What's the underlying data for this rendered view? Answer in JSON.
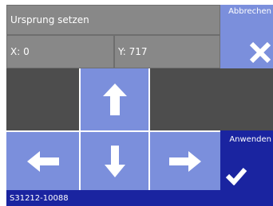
{
  "header": {
    "title": "Ursprung setzen"
  },
  "coords": {
    "x_label": "X: 0",
    "y_label": "Y: 717"
  },
  "actions": {
    "cancel_label": "Abbrechen",
    "apply_label": "Anwenden"
  },
  "icons": {
    "cancel": "close-icon",
    "apply": "checkmark-icon",
    "up": "arrow-up-icon",
    "down": "arrow-down-icon",
    "left": "arrow-left-icon",
    "right": "arrow-right-icon"
  },
  "colors": {
    "field": "#888888",
    "tile_dark": "#4d4d4d",
    "accent_light": "#7b8fdc",
    "accent_dark": "#1a24a0"
  },
  "status": {
    "serial": "S31212-10088"
  }
}
